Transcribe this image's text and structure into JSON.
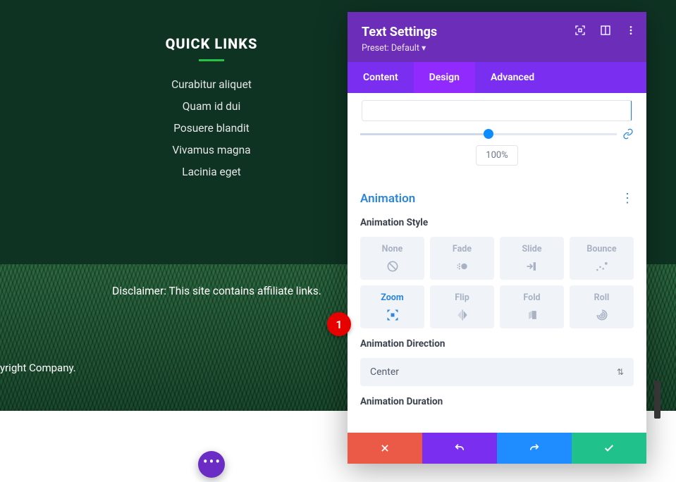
{
  "page": {
    "quick_links": {
      "title": "QUICK LINKS",
      "items": [
        "Curabitur aliquet",
        "Quam id dui",
        "Posuere blandit",
        "Vivamus magna",
        "Lacinia eget"
      ]
    },
    "disclaimer": "Disclaimer: This site contains affiliate links.",
    "copyright": "yright Company."
  },
  "panel": {
    "title": "Text Settings",
    "preset": "Preset: Default ▾",
    "tabs": {
      "content": "Content",
      "design": "Design",
      "advanced": "Advanced",
      "active": "design"
    },
    "slider_value": "100%",
    "section_animation": "Animation",
    "label_style": "Animation Style",
    "styles": [
      {
        "key": "none",
        "label": "None"
      },
      {
        "key": "fade",
        "label": "Fade"
      },
      {
        "key": "slide",
        "label": "Slide"
      },
      {
        "key": "bounce",
        "label": "Bounce"
      },
      {
        "key": "zoom",
        "label": "Zoom"
      },
      {
        "key": "flip",
        "label": "Flip"
      },
      {
        "key": "fold",
        "label": "Fold"
      },
      {
        "key": "roll",
        "label": "Roll"
      }
    ],
    "style_selected": "zoom",
    "label_direction": "Animation Direction",
    "direction_value": "Center",
    "label_duration": "Animation Duration"
  },
  "annotation": {
    "badge_1": "1"
  }
}
